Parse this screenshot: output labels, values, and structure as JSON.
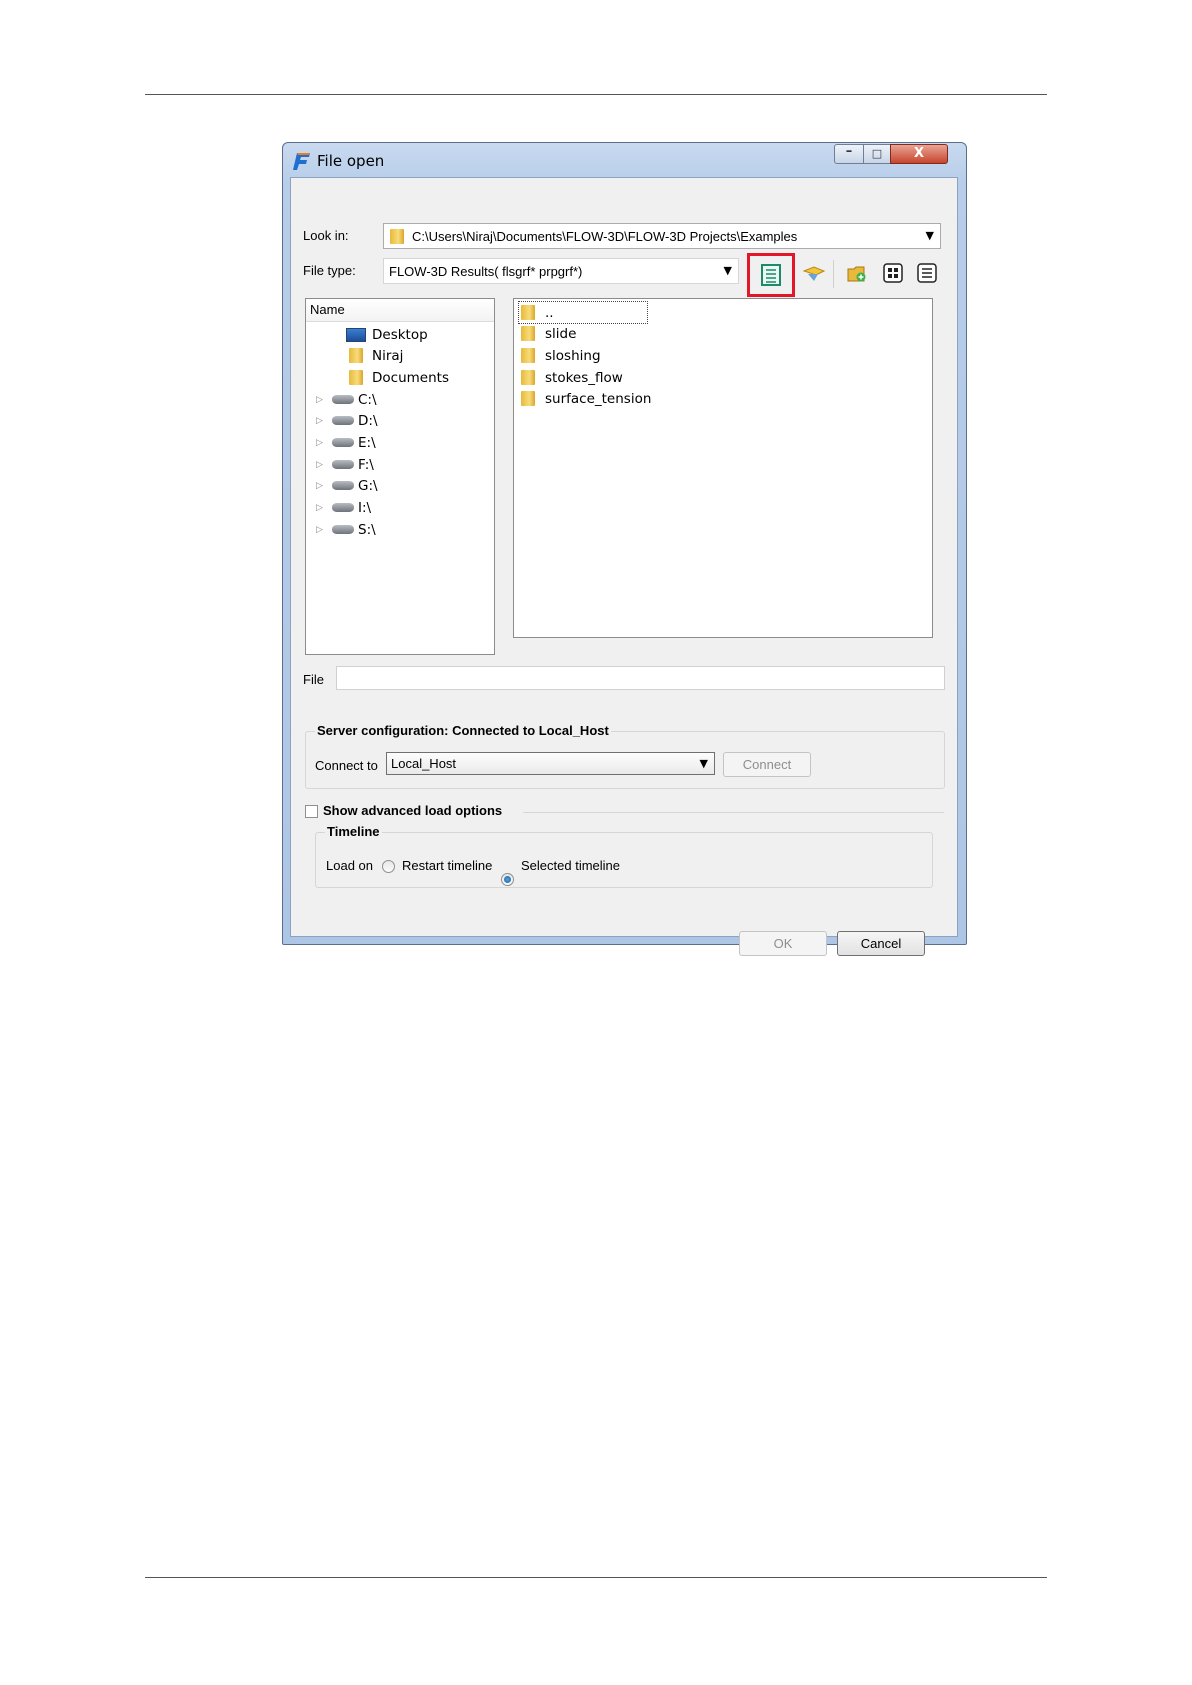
{
  "dialog": {
    "title": "File open",
    "controls": {
      "minimize": "–",
      "maximize": "□",
      "close": "X"
    }
  },
  "look_in": {
    "label": "Look in:",
    "path": "C:\\Users\\Niraj\\Documents\\FLOW-3D\\FLOW-3D Projects\\Examples"
  },
  "file_type": {
    "label": "File type:",
    "value": "FLOW-3D Results( flsgrf* prpgrf*)"
  },
  "toolbar": {
    "icons": [
      "detail-view-icon",
      "back-icon",
      "new-folder-icon",
      "list-mode-icon",
      "detail-mode-icon"
    ],
    "highlight_color": "#e3172a"
  },
  "sidebar": {
    "header": "Name",
    "items": [
      {
        "label": "Desktop",
        "icon": "desktop-icon",
        "expandable": false
      },
      {
        "label": "Niraj",
        "icon": "folder-icon",
        "expandable": false
      },
      {
        "label": "Documents",
        "icon": "folder-icon",
        "expandable": false
      },
      {
        "label": "C:\\",
        "icon": "drive-icon",
        "expandable": true
      },
      {
        "label": "D:\\",
        "icon": "drive-icon",
        "expandable": true
      },
      {
        "label": "E:\\",
        "icon": "drive-icon",
        "expandable": true
      },
      {
        "label": "F:\\",
        "icon": "drive-icon",
        "expandable": true
      },
      {
        "label": "G:\\",
        "icon": "drive-icon",
        "expandable": true
      },
      {
        "label": "I:\\",
        "icon": "drive-icon",
        "expandable": true
      },
      {
        "label": "S:\\",
        "icon": "drive-icon",
        "expandable": true
      }
    ]
  },
  "files": [
    {
      "name": "..",
      "focused": true
    },
    {
      "name": "slide"
    },
    {
      "name": "sloshing"
    },
    {
      "name": "stokes_flow"
    },
    {
      "name": "surface_tension"
    }
  ],
  "file_field": {
    "label": "File",
    "value": ""
  },
  "server": {
    "title": "Server configuration: Connected to Local_Host",
    "connect_label": "Connect to",
    "host": "Local_Host",
    "connect_button": "Connect"
  },
  "advanced": {
    "label": "Show advanced load options",
    "checked": false
  },
  "timeline": {
    "title": "Timeline",
    "load_on_label": "Load on",
    "options": [
      {
        "label": "Restart timeline",
        "selected": false
      },
      {
        "label": "Selected timeline",
        "selected": true
      }
    ]
  },
  "buttons": {
    "ok": "OK",
    "cancel": "Cancel"
  }
}
